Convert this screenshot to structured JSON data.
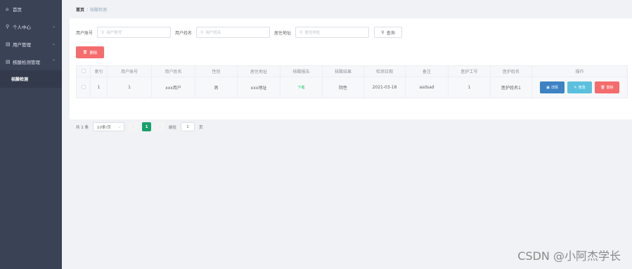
{
  "sidebar": {
    "items": [
      {
        "icon": "home-icon",
        "label": "首页",
        "has_arrow": false
      },
      {
        "icon": "user-icon",
        "label": "个人中心",
        "has_arrow": true
      },
      {
        "icon": "users-icon",
        "label": "用户管理",
        "has_arrow": true
      },
      {
        "icon": "list-icon",
        "label": "核酸检测管理",
        "has_arrow": true
      }
    ],
    "sub_item": "核酸检测"
  },
  "breadcrumb": {
    "home": "首页",
    "separator": "/",
    "current": "核酸检测"
  },
  "search": {
    "account_label": "用户账号",
    "account_placeholder": "用户账号",
    "name_label": "用户姓名",
    "name_placeholder": "用户姓名",
    "address_label": "居住地址",
    "address_placeholder": "居住地址",
    "query_button": "查询"
  },
  "delete_button": "删除",
  "table": {
    "headers": [
      "索引",
      "用户账号",
      "用户姓名",
      "性别",
      "居住地址",
      "核酸报告",
      "核酸结果",
      "检测日期",
      "备注",
      "医护工号",
      "医护姓名",
      "操作"
    ],
    "rows": [
      {
        "index": "1",
        "account": "1",
        "name": "xxx用户",
        "gender": "男",
        "address": "xxx地址",
        "report": "下载",
        "result": "阴性",
        "date": "2021-03-18",
        "note": "asdsad",
        "staff_no": "1",
        "staff_name": "医护姓名1"
      }
    ],
    "actions": {
      "detail": "详情",
      "edit": "修改",
      "delete": "删除"
    }
  },
  "pagination": {
    "total": "共 1 条",
    "page_size": "10条/页",
    "current_page": "1",
    "goto_label": "前往",
    "goto_value": "1",
    "page_suffix": "页"
  },
  "watermark": "CSDN @小阿杰学长",
  "colors": {
    "sidebar_bg": "#3a4256",
    "danger": "#f56c6c",
    "primary": "#3d82c4",
    "info": "#5bc0de",
    "active_page": "#1a9f6a"
  }
}
